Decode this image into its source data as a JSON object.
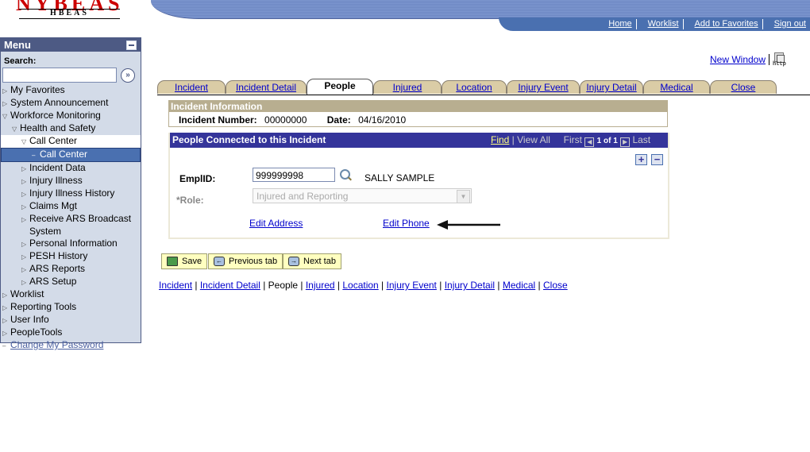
{
  "logo": {
    "title": "NYBEAS",
    "subtitle": "HBEAS"
  },
  "topnav": [
    {
      "label": "Home"
    },
    {
      "label": "Worklist"
    },
    {
      "label": "Add to Favorites"
    },
    {
      "label": "Sign out"
    }
  ],
  "new_window": {
    "label": "New Window",
    "icon": "http-icon",
    "icon_text": "http"
  },
  "menu": {
    "title": "Menu",
    "search_label": "Search:",
    "search_value": "",
    "go_glyph": "»",
    "items": [
      {
        "label": "My Favorites",
        "level": 0,
        "state": "collapsed"
      },
      {
        "label": "System Announcement",
        "level": 0,
        "state": "collapsed"
      },
      {
        "label": "Workforce Monitoring",
        "level": 0,
        "state": "expanded"
      },
      {
        "label": "Health and Safety",
        "level": 1,
        "state": "expanded"
      },
      {
        "label": "Call Center",
        "level": 2,
        "state": "expanded",
        "highlight": "white"
      },
      {
        "label": "Call Center",
        "level": 3,
        "state": "leaf",
        "highlight": "selected"
      },
      {
        "label": "Incident Data",
        "level": 2,
        "state": "collapsed"
      },
      {
        "label": "Injury Illness",
        "level": 2,
        "state": "collapsed"
      },
      {
        "label": "Injury Illness History",
        "level": 2,
        "state": "collapsed"
      },
      {
        "label": "Claims Mgt",
        "level": 2,
        "state": "collapsed"
      },
      {
        "label": "Receive ARS Broadcast",
        "label2": "System",
        "level": 2,
        "state": "collapsed"
      },
      {
        "label": "Personal Information",
        "level": 2,
        "state": "collapsed"
      },
      {
        "label": "PESH History",
        "level": 2,
        "state": "collapsed"
      },
      {
        "label": "ARS Reports",
        "level": 2,
        "state": "collapsed"
      },
      {
        "label": "ARS Setup",
        "level": 2,
        "state": "collapsed"
      },
      {
        "label": "Worklist",
        "level": 0,
        "state": "collapsed"
      },
      {
        "label": "Reporting Tools",
        "level": 0,
        "state": "collapsed"
      },
      {
        "label": "User Info",
        "level": 0,
        "state": "collapsed"
      },
      {
        "label": "PeopleTools",
        "level": 0,
        "state": "collapsed"
      },
      {
        "label": "Change My Password",
        "level": 0,
        "state": "link"
      }
    ]
  },
  "tabs": [
    {
      "label": "Incident",
      "active": false
    },
    {
      "label": "Incident Detail",
      "active": false
    },
    {
      "label": "People",
      "active": true
    },
    {
      "label": "Injured",
      "active": false
    },
    {
      "label": "Location",
      "active": false
    },
    {
      "label": "Injury Event",
      "active": false
    },
    {
      "label": "Injury Detail",
      "active": false
    },
    {
      "label": "Medical",
      "active": false
    },
    {
      "label": "Close",
      "active": false
    }
  ],
  "incident_info": {
    "title": "Incident Information",
    "number_label": "Incident Number:",
    "number_value": "00000000",
    "date_label": "Date:",
    "date_value": "04/16/2010"
  },
  "people": {
    "title": "People Connected to this Incident",
    "find": "Find",
    "view_all": "View All",
    "first": "First",
    "page": "1 of 1",
    "last": "Last",
    "add": "+",
    "remove": "−",
    "emplid_label": "EmplID:",
    "emplid_value": "999999998",
    "emp_name": "SALLY SAMPLE",
    "role_label": "*Role:",
    "role_value": "Injured and Reporting",
    "edit_address": "Edit Address",
    "edit_phone": "Edit Phone"
  },
  "buttons": {
    "save": "Save",
    "previous": "Previous tab",
    "next": "Next tab"
  },
  "bottom_links": [
    "Incident",
    "Incident Detail",
    "People",
    "Injured",
    "Location",
    "Injury Event",
    "Injury Detail",
    "Medical",
    "Close"
  ],
  "colors": {
    "menu_header": "#4d5a84",
    "grid_header": "#34349a",
    "tab": "#dacca6",
    "info_header": "#b8ae90",
    "button": "#ffffc0"
  }
}
